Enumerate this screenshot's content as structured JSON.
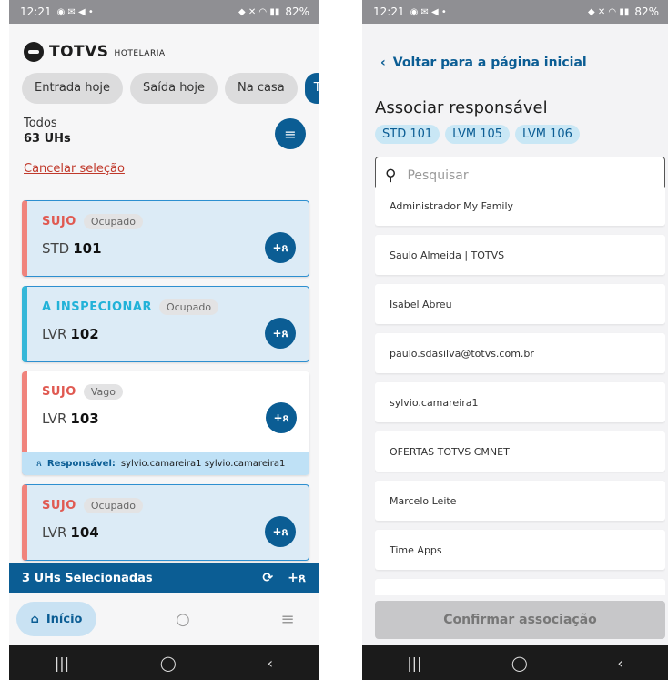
{
  "status_bar": {
    "time": "12:21",
    "battery": "82%"
  },
  "left": {
    "brand": {
      "name": "TOTVS",
      "sub": "HOTELARIA"
    },
    "filters": [
      "Entrada hoje",
      "Saída hoje",
      "Na casa",
      "T"
    ],
    "summary": {
      "label": "Todos",
      "count": "63 UHs"
    },
    "cancel_label": "Cancelar seleção",
    "rooms": [
      {
        "status": "SUJO",
        "occupancy": "Ocupado",
        "type": "STD",
        "number": "101",
        "selected": true
      },
      {
        "status": "A INSPECIONAR",
        "occupancy": "Ocupado",
        "type": "LVR",
        "number": "102",
        "selected": true
      },
      {
        "status": "SUJO",
        "occupancy": "Vago",
        "type": "LVR",
        "number": "103",
        "selected": false,
        "responsible_label": "Responsável:",
        "responsible_value": "sylvio.camareira1 sylvio.camareira1"
      },
      {
        "status": "SUJO",
        "occupancy": "Ocupado",
        "type": "LVR",
        "number": "104",
        "selected": true
      }
    ],
    "selection_bar": {
      "label": "3 UHs Selecionadas"
    },
    "nav": {
      "home": "Início"
    }
  },
  "right": {
    "back_label": "Voltar para a página inicial",
    "title": "Associar responsável",
    "tags": [
      "STD 101",
      "LVM 105",
      "LVM 106"
    ],
    "search_placeholder": "Pesquisar",
    "users": [
      "Administrador My Family",
      "Saulo Almeida | TOTVS",
      "Isabel Abreu",
      "paulo.sdasilva@totvs.com.br",
      "sylvio.camareira1",
      "OFERTAS TOTVS CMNET",
      "Marcelo Leite",
      "Time Apps",
      ""
    ],
    "confirm_label": "Confirmar associação"
  },
  "colors": {
    "primary": "#0b5d94",
    "dirty": "#e05a52",
    "inspect": "#22b2d8"
  },
  "icons": [
    "filter-icon",
    "add-person-icon",
    "refresh-icon",
    "home-icon",
    "search-icon",
    "menu-icon",
    "back-chevron-icon"
  ]
}
